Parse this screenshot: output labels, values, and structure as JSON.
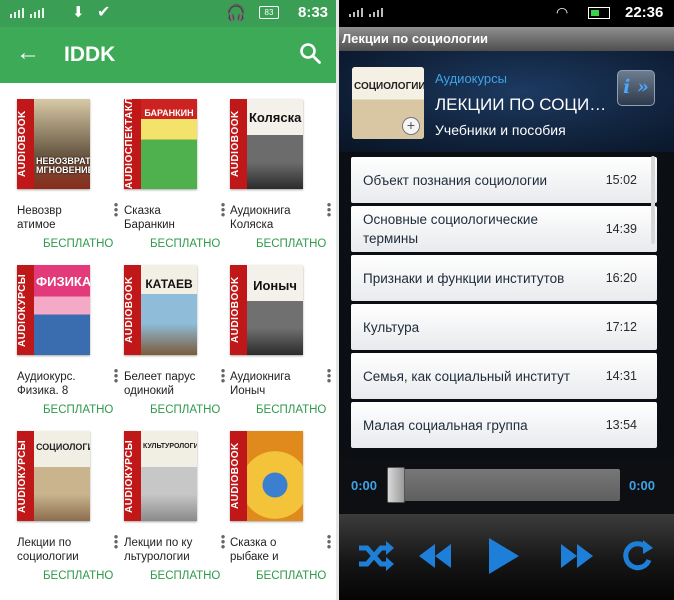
{
  "left": {
    "status": {
      "battery": "83",
      "time": "8:33"
    },
    "appbar": {
      "title": "IDDK"
    },
    "books": [
      {
        "name": "Невозвр атимое",
        "price": "БЕСПЛАТНО",
        "spine": "AUDIOBOOK",
        "cover_text": "НЕВОЗВРАТИМОЕ МГНОВЕНИЕ"
      },
      {
        "name": "Сказка Баранкин",
        "price": "БЕСПЛАТНО",
        "spine": "AUDIOСПЕКТАКЛЬ",
        "cover_text": "БАРАНКИН"
      },
      {
        "name": "Аудиокнига Коляска",
        "price": "БЕСПЛАТНО",
        "spine": "AUDIOBOOK",
        "cover_text": "Коляска"
      },
      {
        "name": "Аудиокурс. Физика. 8",
        "price": "БЕСПЛАТНО",
        "spine": "AUDIOКУРСЫ",
        "cover_text": "ФИЗИКА"
      },
      {
        "name": "Белеет парус одинокий",
        "price": "БЕСПЛАТНО",
        "spine": "AUDIOBOOK",
        "cover_text": "КАТАЕВ"
      },
      {
        "name": "Аудиокнига Ионыч",
        "price": "БЕСПЛАТНО",
        "spine": "AUDIOBOOK",
        "cover_text": "Ионыч"
      },
      {
        "name": "Лекции по социологии",
        "price": "БЕСПЛАТНО",
        "spine": "AUDIOКУРСЫ",
        "cover_text": "СОЦИОЛОГИИ"
      },
      {
        "name": "Лекции по ку льтурологии",
        "price": "БЕСПЛАТНО",
        "spine": "AUDIOКУРСЫ",
        "cover_text": "КУЛЬТУРОЛОГИИ"
      },
      {
        "name": "Сказка о рыбаке и",
        "price": "БЕСПЛАТНО",
        "spine": "AUDIOBOOK",
        "cover_text": ""
      }
    ]
  },
  "right": {
    "status": {
      "time": "22:36"
    },
    "title_bar": "Лекции по социологии",
    "header": {
      "category": "Аудиокурсы",
      "track_title": "ЛЕКЦИИ ПО СОЦИОЛОГИИ",
      "subtitle": "Учебники и пособия",
      "info_label": "i »",
      "thumb_text": "СОЦИОЛОГИИ"
    },
    "playlist": [
      {
        "title": "Объект познания социологии",
        "duration": "15:02"
      },
      {
        "title": "Основные социологические термины",
        "duration": "14:39"
      },
      {
        "title": "Признаки и функции институтов",
        "duration": "16:20"
      },
      {
        "title": "Культура",
        "duration": "17:12"
      },
      {
        "title": "Семья, как социальный институт",
        "duration": "14:31"
      },
      {
        "title": "Малая социальная группа",
        "duration": "13:54"
      }
    ],
    "player": {
      "position": "0:00",
      "duration": "0:00",
      "progress": 0
    },
    "colors": {
      "accent": "#3fa3e6",
      "green": "#3daa58"
    }
  }
}
